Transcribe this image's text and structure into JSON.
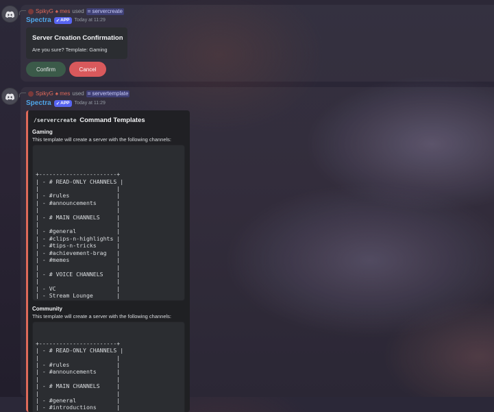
{
  "messages": [
    {
      "reply": {
        "username": "SpikyG",
        "mention": "♠ mes",
        "used": "used",
        "command": "⌗ servercreate"
      },
      "author": "Spectra",
      "badge": "APP",
      "timestamp": "Today at 11:29",
      "embed": {
        "title": "Server Creation Confirmation",
        "description": "Are you sure? Template: Gaming"
      },
      "buttons": {
        "confirm": "Confirm",
        "cancel": "Cancel"
      }
    },
    {
      "reply": {
        "username": "SpikyG",
        "mention": "♠ mes",
        "used": "used",
        "command": "⌗ servertemplate"
      },
      "author": "Spectra",
      "badge": "APP",
      "timestamp": "Today at 11:29",
      "embed": {
        "title_code": "/servercreate",
        "title_rest": "Command Templates",
        "fields": [
          {
            "name": "Gaming",
            "description": "This template will create a server with the following channels:",
            "code": "\n+-----------------------+\n| - # READ-ONLY CHANNELS |\n|                       |\n| - #rules              |\n| - #announcements      |\n|                       |\n| - # MAIN CHANNELS     |\n|                       |\n| - #general            |\n| - #clips-n-highlights |\n| - #tips-n-tricks      |\n| - #achievement-brag   |\n| - #memes              |\n|                       |\n| - # VOICE CHANNELS    |\n|                       |\n| - VC                  |\n| - Stream Lounge       |\n| - Party Chat          |\n+-----------------------+"
          },
          {
            "name": "Community",
            "description": "This template will create a server with the following channels:",
            "code": "+-----------------------+\n| - # READ-ONLY CHANNELS |\n|                       |\n| - #rules              |\n| - #announcements      |\n|                       |\n| - # MAIN CHANNELS     |\n|                       |\n| - #general            |\n| - #introductions      |"
          }
        ]
      }
    }
  ]
}
